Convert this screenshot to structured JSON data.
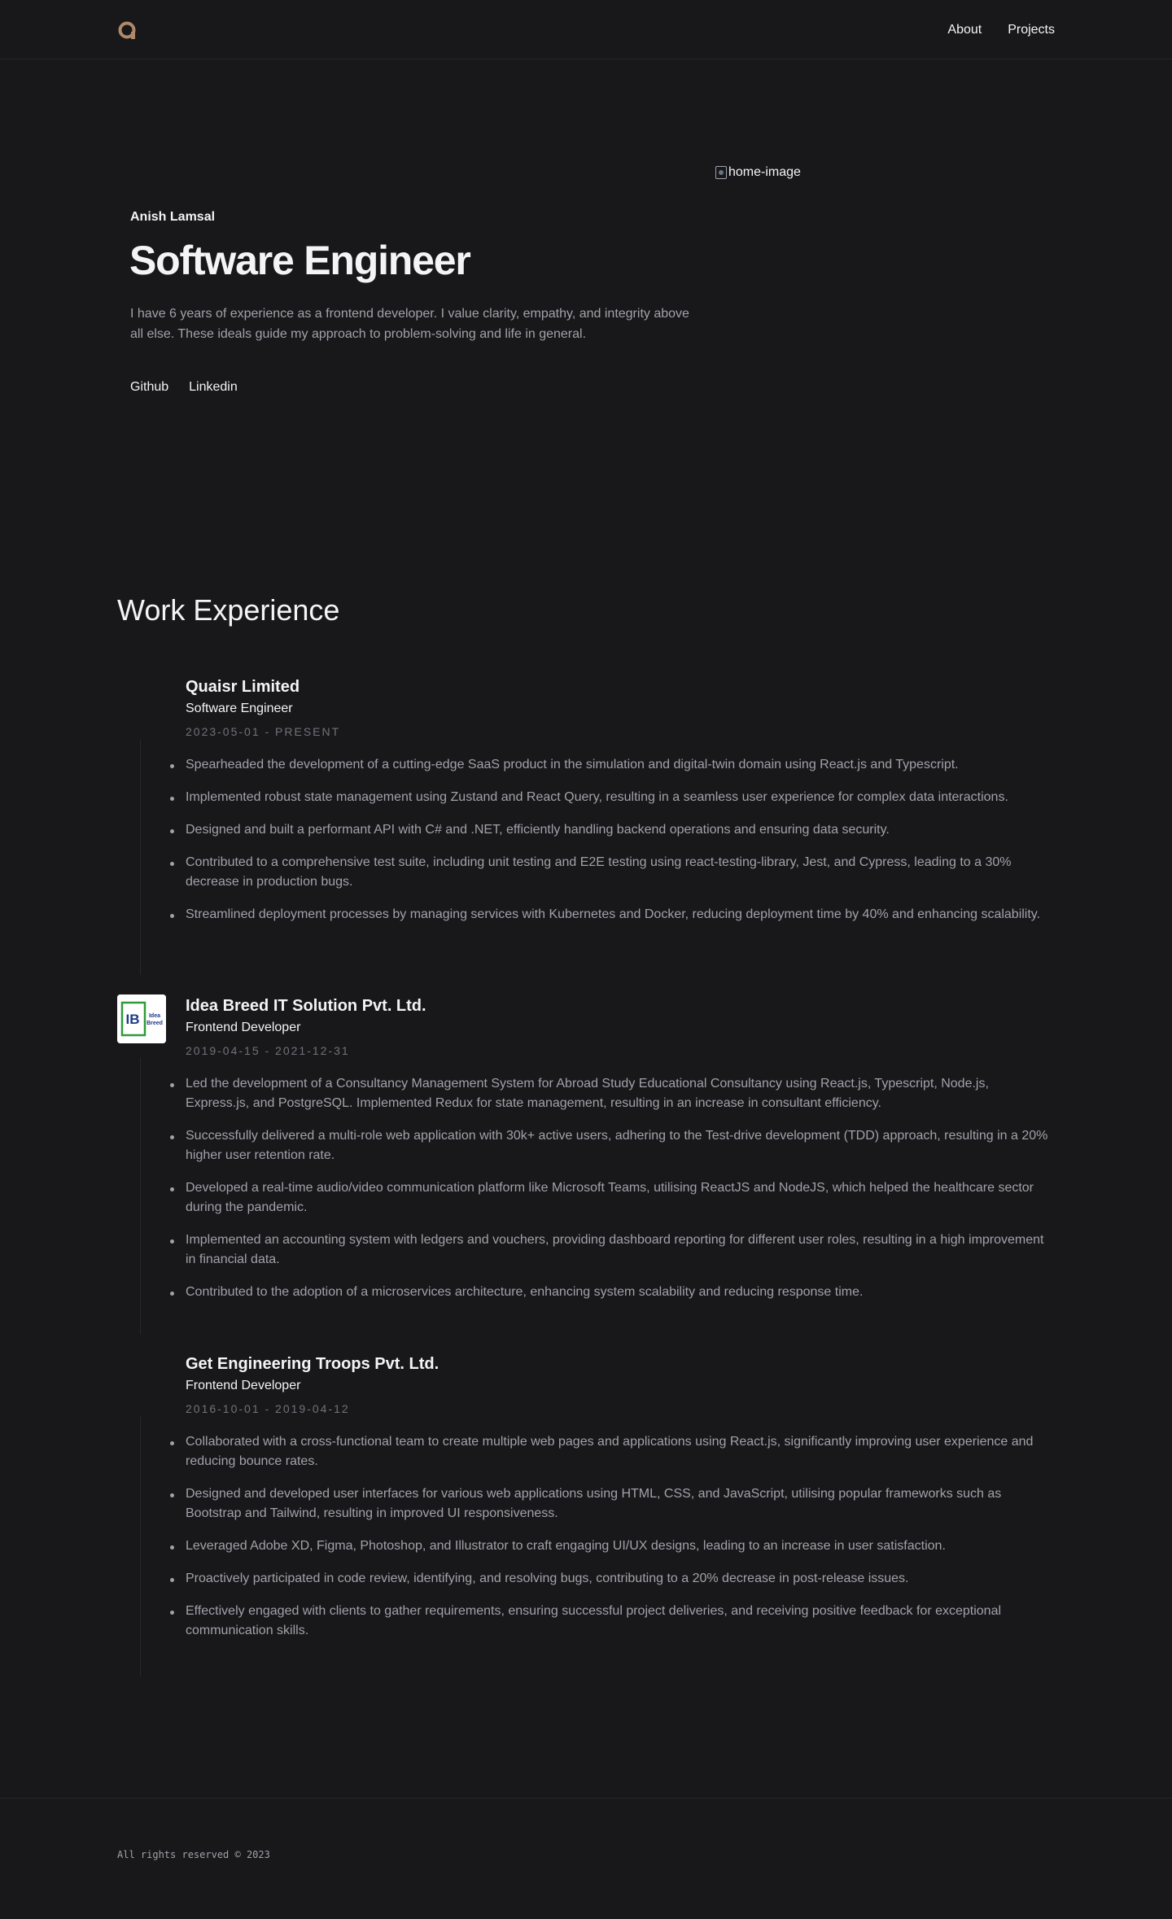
{
  "header": {
    "logo_icon": "ring-logo-icon",
    "logo_color": "#b08968",
    "nav": [
      {
        "label": "About"
      },
      {
        "label": "Projects"
      }
    ]
  },
  "hero": {
    "image_alt": "home-image",
    "name": "Anish Lamsal",
    "title": "Software Engineer",
    "description": "I have 6 years of experience as a frontend developer. I value clarity, empathy, and integrity above all else. These ideals guide my approach to problem-solving and life in general.",
    "links": [
      {
        "label": "Github"
      },
      {
        "label": "Linkedin"
      }
    ]
  },
  "work": {
    "title": "Work Experience",
    "jobs": [
      {
        "company": "Quaisr Limited",
        "role": "Software Engineer",
        "dates": "2023-05-01 - PRESENT",
        "has_logo": false,
        "points": [
          "Spearheaded the development of a cutting-edge SaaS product in the simulation and digital-twin domain using React.js and Typescript.",
          "Implemented robust state management using Zustand and React Query, resulting in a seamless user experience for complex data interactions.",
          "Designed and built a performant API with C# and .NET, efficiently handling backend operations and ensuring data security.",
          "Contributed to a comprehensive test suite, including unit testing and E2E testing using react-testing-library, Jest, and Cypress, leading to a 30% decrease in production bugs.",
          "Streamlined deployment processes by managing services with Kubernetes and Docker, reducing deployment time by 40% and enhancing scalability."
        ]
      },
      {
        "company": "Idea Breed IT Solution Pvt. Ltd.",
        "role": "Frontend Developer",
        "dates": "2019-04-15 - 2021-12-31",
        "has_logo": true,
        "logo_text": {
          "initials": "IB",
          "line1": "Idea",
          "line2": "Breed"
        },
        "points": [
          "Led the development of a Consultancy Management System for Abroad Study Educational Consultancy using React.js, Typescript, Node.js, Express.js, and PostgreSQL. Implemented Redux for state management, resulting in an increase in consultant efficiency.",
          "Successfully delivered a multi-role web application with 30k+ active users, adhering to the Test-drive development (TDD) approach, resulting in a 20% higher user retention rate.",
          "Developed a real-time audio/video communication platform like Microsoft Teams, utilising ReactJS and NodeJS, which helped the healthcare sector during the pandemic.",
          "Implemented an accounting system with ledgers and vouchers, providing dashboard reporting for different user roles, resulting in a high improvement in financial data.",
          "Contributed to the adoption of a microservices architecture, enhancing system scalability and reducing response time."
        ]
      },
      {
        "company": "Get Engineering Troops Pvt. Ltd.",
        "role": "Frontend Developer",
        "dates": "2016-10-01 - 2019-04-12",
        "has_logo": false,
        "points": [
          "Collaborated with a cross-functional team to create multiple web pages and applications using React.js, significantly improving user experience and reducing bounce rates.",
          "Designed and developed user interfaces for various web applications using HTML, CSS, and JavaScript, utilising popular frameworks such as Bootstrap and Tailwind, resulting in improved UI responsiveness.",
          "Leveraged Adobe XD, Figma, Photoshop, and Illustrator to craft engaging UI/UX designs, leading to an increase in user satisfaction.",
          "Proactively participated in code review, identifying, and resolving bugs, contributing to a 20% decrease in post-release issues.",
          "Effectively engaged with clients to gather requirements, ensuring successful project deliveries, and receiving positive feedback for exceptional communication skills."
        ]
      }
    ]
  },
  "footer": {
    "text": "All rights reserved © 2023"
  }
}
